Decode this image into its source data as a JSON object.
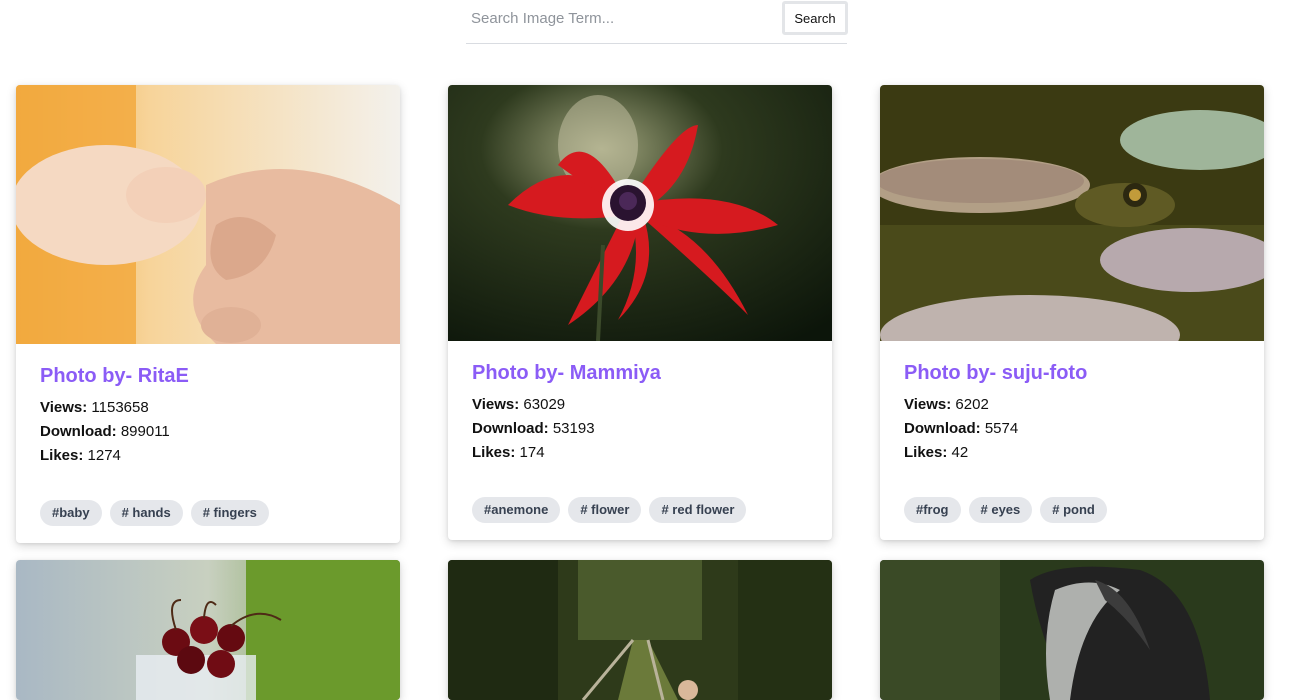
{
  "search": {
    "placeholder": "Search Image Term...",
    "button_label": "Search"
  },
  "labels": {
    "views": "Views:",
    "downloads": "Download:",
    "likes": "Likes:"
  },
  "cards": [
    {
      "title": "Photo by- RitaE",
      "views": "1153658",
      "downloads": "899011",
      "likes": "1274",
      "tags": [
        "#baby",
        "# hands",
        "# fingers"
      ],
      "image_icon": "baby-hand-photo"
    },
    {
      "title": "Photo by- Mammiya",
      "views": "63029",
      "downloads": "53193",
      "likes": "174",
      "tags": [
        "#anemone",
        "# flower",
        "# red flower"
      ],
      "image_icon": "red-anemone-photo"
    },
    {
      "title": "Photo by- suju-foto",
      "views": "6202",
      "downloads": "5574",
      "likes": "42",
      "tags": [
        "#frog",
        "# eyes",
        "# pond"
      ],
      "image_icon": "frog-pond-photo"
    }
  ],
  "colors": {
    "title": "#8b5cf6",
    "tag_bg": "#e5e7eb",
    "tag_text": "#374151"
  }
}
